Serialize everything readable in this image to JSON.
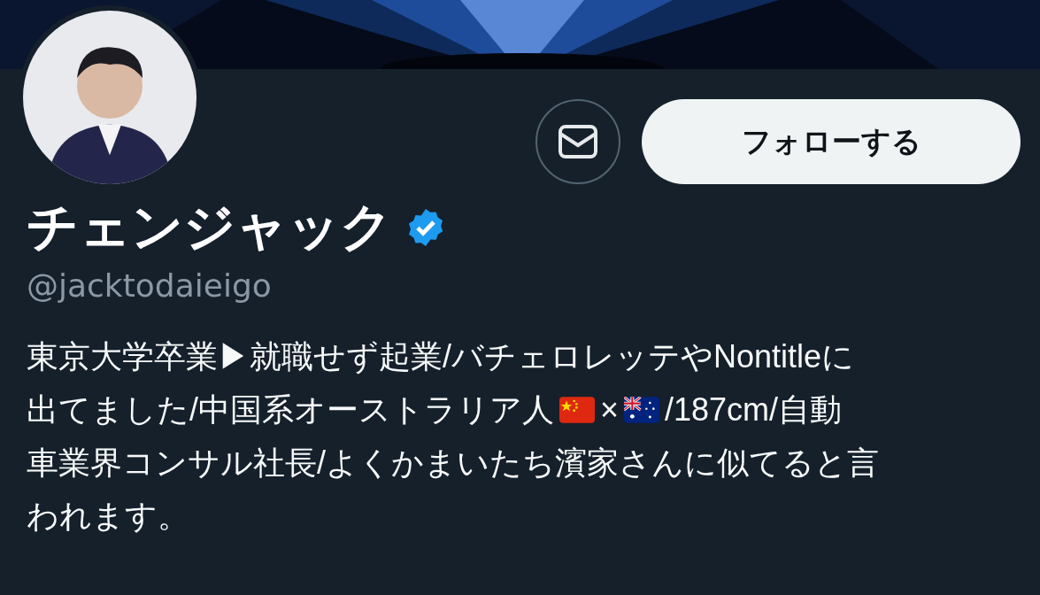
{
  "follow_button": {
    "label": "フォローする"
  },
  "profile": {
    "name": "チェンジャック",
    "verified": true,
    "handle": "@jacktodaieigo"
  },
  "bio": [
    [
      {
        "kind": "text",
        "text": "東京大学卒業▶就職せず起業/バチェロレッテやNontitleに"
      }
    ],
    [
      {
        "kind": "text",
        "text": "出てました/中国系オーストラリア人"
      },
      {
        "kind": "china_flag"
      },
      {
        "kind": "text",
        "text": "×"
      },
      {
        "kind": "australia_flag"
      },
      {
        "kind": "text",
        "text": "/187cm/自動"
      }
    ],
    [
      {
        "kind": "text",
        "text": "車業界コンサル社長/よくかまいたち濱家さんに似てると言"
      }
    ],
    [
      {
        "kind": "text",
        "text": "われます。"
      }
    ]
  ]
}
